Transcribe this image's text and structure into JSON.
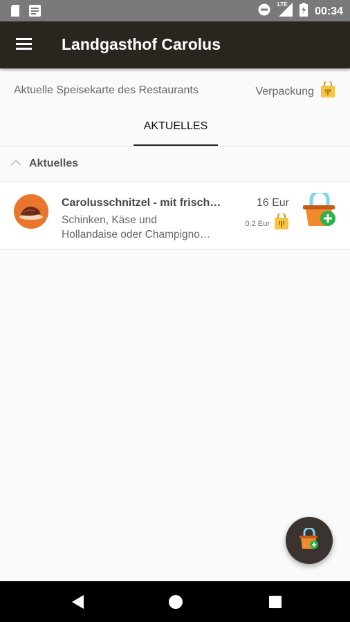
{
  "status_bar": {
    "time": "00:34",
    "network_label": "LTE",
    "icons": [
      "sd-card-icon",
      "notification-icon",
      "do-not-disturb-icon",
      "signal-icon",
      "battery-icon"
    ]
  },
  "app_bar": {
    "title": "Landgasthof Carolus",
    "menu_icon": "hamburger-menu-icon"
  },
  "header": {
    "subtitle": "Aktuelle Speisekarte des Restaurants",
    "packaging_label": "Verpackung",
    "packaging_icon": "takeaway-bag-icon"
  },
  "tabs": [
    {
      "label": "AKTUELLES",
      "selected": true
    }
  ],
  "section": {
    "title": "Aktuelles",
    "expanded": true
  },
  "items": [
    {
      "name": "Carolusschnitzel - mit frisch…",
      "description_line1": "Schinken, Käse und",
      "description_line2": "Hollandaise oder Champigno…",
      "price": "16 Eur",
      "packaging_price": "0.2 Eur",
      "thumbnail_icon": "schnitzel-food-icon",
      "add_icon": "add-to-basket-icon"
    }
  ],
  "fab": {
    "icon": "basket-icon"
  },
  "nav_bar": {
    "icons": [
      "back-icon",
      "home-icon",
      "recents-icon"
    ]
  },
  "colors": {
    "app_bar": "#2b2520",
    "status_bar": "#7a7a7a",
    "accent_orange": "#e8762c",
    "basket_blue": "#7fd3ee",
    "add_green": "#2bb24c",
    "bag_yellow": "#f5c443"
  }
}
